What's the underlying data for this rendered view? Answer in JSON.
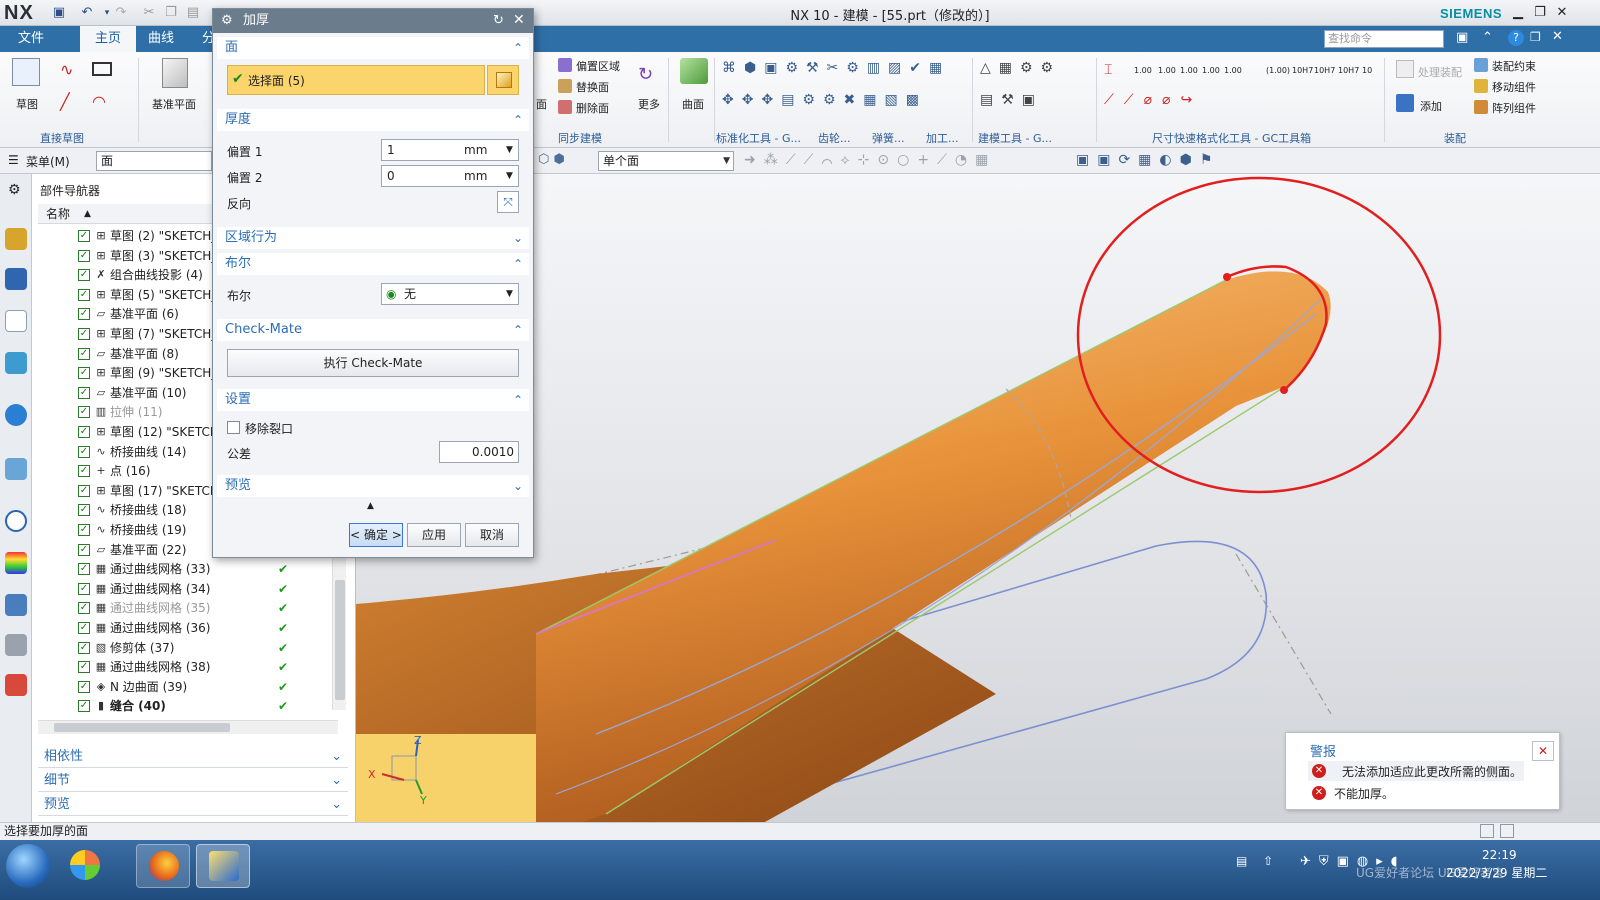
{
  "window": {
    "logo": "NX",
    "title": "NX 10 - 建模 - [55.prt（修改的）]",
    "brand": "SIEMENS"
  },
  "ribbon_tabs": [
    {
      "label": "文件(F)"
    },
    {
      "label": "主页"
    },
    {
      "label": "曲线"
    },
    {
      "label": "分"
    }
  ],
  "search": {
    "placeholder": "查找命令"
  },
  "ribbon": {
    "sketch_label": "草图",
    "datum_plane_label": "基准平面",
    "direct_sketch_group": "直接草图",
    "offset_region": "偏置区域",
    "replace_face": "替换面",
    "delete_face": "删除面",
    "face_short": "面",
    "more": "更多",
    "surface": "曲面",
    "sync_modeling_group": "同步建模",
    "standard_tools_group": "标准化工具 - G...",
    "gear_group": "齿轮...",
    "spring_group": "弹簧...",
    "machining_group": "加工...",
    "modeling_tools_group": "建模工具 - G...",
    "dim_group": "尺寸快速格式化工具 - GC工具箱",
    "dim_values": [
      "1.00",
      "1.00",
      "1.00",
      "1.00",
      "1.00",
      "(1.00)",
      "10H7",
      "10H7",
      "10H7",
      "10"
    ],
    "assembly_constraint": "装配约束",
    "move_component": "移动组件",
    "pattern_component": "阵列组件",
    "add": "添加",
    "process_assembly": "处理装配",
    "assembly_group": "装配"
  },
  "cmdbar": {
    "menu_label": "菜单(M)",
    "filter_value": "面",
    "face_rule_value": "单个面"
  },
  "navigator": {
    "title": "部件导航器",
    "column_name": "名称",
    "items": [
      {
        "label": "草图 (2) \"SKETCH_",
        "icon": "sketch-icon",
        "dim": false,
        "ok": false
      },
      {
        "label": "草图 (3) \"SKETCH_",
        "icon": "sketch-icon",
        "dim": false,
        "ok": false
      },
      {
        "label": "组合曲线投影 (4)",
        "icon": "projection-icon",
        "dim": false,
        "ok": false
      },
      {
        "label": "草图 (5) \"SKETCH_",
        "icon": "sketch-icon",
        "dim": false,
        "ok": false
      },
      {
        "label": "基准平面 (6)",
        "icon": "datum-plane-icon",
        "dim": false,
        "ok": false
      },
      {
        "label": "草图 (7) \"SKETCH_",
        "icon": "sketch-icon",
        "dim": false,
        "ok": false
      },
      {
        "label": "基准平面 (8)",
        "icon": "datum-plane-icon",
        "dim": false,
        "ok": false
      },
      {
        "label": "草图 (9) \"SKETCH_",
        "icon": "sketch-icon",
        "dim": false,
        "ok": false
      },
      {
        "label": "基准平面 (10)",
        "icon": "datum-plane-icon",
        "dim": false,
        "ok": false
      },
      {
        "label": "拉伸 (11)",
        "icon": "extrude-icon",
        "dim": true,
        "ok": false
      },
      {
        "label": "草图 (12) \"SKETCH",
        "icon": "sketch-icon",
        "dim": false,
        "ok": false
      },
      {
        "label": "桥接曲线 (14)",
        "icon": "bridge-curve-icon",
        "dim": false,
        "ok": false
      },
      {
        "label": "点 (16)",
        "icon": "point-icon",
        "dim": false,
        "ok": false
      },
      {
        "label": "草图 (17) \"SKETCH",
        "icon": "sketch-icon",
        "dim": false,
        "ok": false
      },
      {
        "label": "桥接曲线 (18)",
        "icon": "bridge-curve-icon",
        "dim": false,
        "ok": false
      },
      {
        "label": "桥接曲线 (19)",
        "icon": "bridge-curve-icon",
        "dim": false,
        "ok": false
      },
      {
        "label": "基准平面 (22)",
        "icon": "datum-plane-icon",
        "dim": false,
        "ok": false
      },
      {
        "label": "通过曲线网格 (33)",
        "icon": "mesh-surface-icon",
        "dim": false,
        "ok": true
      },
      {
        "label": "通过曲线网格 (34)",
        "icon": "mesh-surface-icon",
        "dim": false,
        "ok": true
      },
      {
        "label": "通过曲线网格 (35)",
        "icon": "mesh-surface-icon",
        "dim": true,
        "ok": true
      },
      {
        "label": "通过曲线网格 (36)",
        "icon": "mesh-surface-icon",
        "dim": false,
        "ok": true
      },
      {
        "label": "修剪体 (37)",
        "icon": "trim-body-icon",
        "dim": false,
        "ok": true
      },
      {
        "label": "通过曲线网格 (38)",
        "icon": "mesh-surface-icon",
        "dim": false,
        "ok": true
      },
      {
        "label": "N 边曲面 (39)",
        "icon": "n-sided-surface-icon",
        "dim": false,
        "ok": true
      },
      {
        "label": "缝合 (40)",
        "icon": "sew-icon",
        "dim": false,
        "ok": true,
        "bold": true
      }
    ],
    "panels": [
      "相依性",
      "细节",
      "预览"
    ]
  },
  "dialog": {
    "title": "加厚",
    "face_section": "面",
    "select_face": "选择面 (5)",
    "thickness_section": "厚度",
    "offset1_label": "偏置 1",
    "offset1_value": "1",
    "offset1_unit": "mm",
    "offset2_label": "偏置 2",
    "offset2_value": "0",
    "offset2_unit": "mm",
    "reverse_label": "反向",
    "region_section": "区域行为",
    "boolean_section": "布尔",
    "boolean_label": "布尔",
    "boolean_value": "无",
    "checkmate_section": "Check-Mate",
    "run_checkmate": "执行 Check-Mate",
    "settings_section": "设置",
    "remove_gaps": "移除裂口",
    "tolerance_label": "公差",
    "tolerance_value": "0.0010",
    "preview_section": "预览",
    "ok": "< 确定 >",
    "apply": "应用",
    "cancel": "取消"
  },
  "alert": {
    "title": "警报",
    "messages": [
      "无法添加适应此更改所需的侧面。",
      "不能加厚。"
    ]
  },
  "status": {
    "prompt": "选择要加厚的面"
  },
  "taskbar": {
    "time": "22:19",
    "date": "2022/3/29 星期二",
    "watermark": "UG爱好者论坛 UG爱好者宝"
  },
  "colors": {
    "ribbon_blue": "#2f6fa8",
    "dialog_title": "#6b7c8c",
    "section_blue": "#2c6db4",
    "selection_yellow": "#fbd56b",
    "body_orange": "#e89a3c",
    "highlight_red": "#e21e1e",
    "siemens_teal": "#0a8ea3"
  }
}
